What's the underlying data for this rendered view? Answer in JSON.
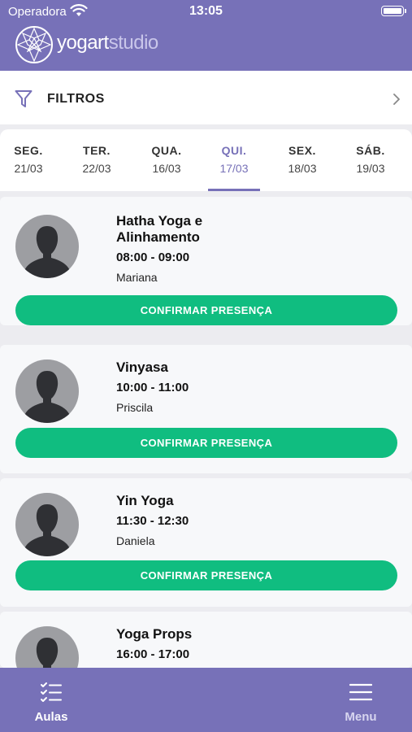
{
  "status_bar": {
    "carrier": "Operadora",
    "time": "13:05"
  },
  "header": {
    "logo_main": "yogart",
    "logo_sub": "studio"
  },
  "filters": {
    "label": "FILTROS"
  },
  "days": [
    {
      "name": "SEG.",
      "date": "21/03",
      "active": false
    },
    {
      "name": "TER.",
      "date": "22/03",
      "active": false
    },
    {
      "name": "QUA.",
      "date": "16/03",
      "active": false
    },
    {
      "name": "QUI.",
      "date": "17/03",
      "active": true
    },
    {
      "name": "SEX.",
      "date": "18/03",
      "active": false
    },
    {
      "name": "SÁB.",
      "date": "19/03",
      "active": false
    }
  ],
  "classes": [
    {
      "title": "Hatha Yoga e Alinhamento",
      "time": "08:00 - 09:00",
      "teacher": "Mariana",
      "button": "CONFIRMAR PRESENÇA"
    },
    {
      "title": "Vinyasa",
      "time": "10:00 - 11:00",
      "teacher": "Priscila",
      "button": "CONFIRMAR PRESENÇA"
    },
    {
      "title": "Yin Yoga",
      "time": "11:30 - 12:30",
      "teacher": "Daniela",
      "button": "CONFIRMAR PRESENÇA"
    },
    {
      "title": "Yoga Props",
      "time": "16:00 - 17:00",
      "teacher": "",
      "button": ""
    }
  ],
  "tabbar": {
    "aulas_label": "Aulas",
    "menu_label": "Menu"
  },
  "colors": {
    "brand": "#7771b8",
    "accent": "#10bd80",
    "avatar": "#9d9ea2"
  }
}
